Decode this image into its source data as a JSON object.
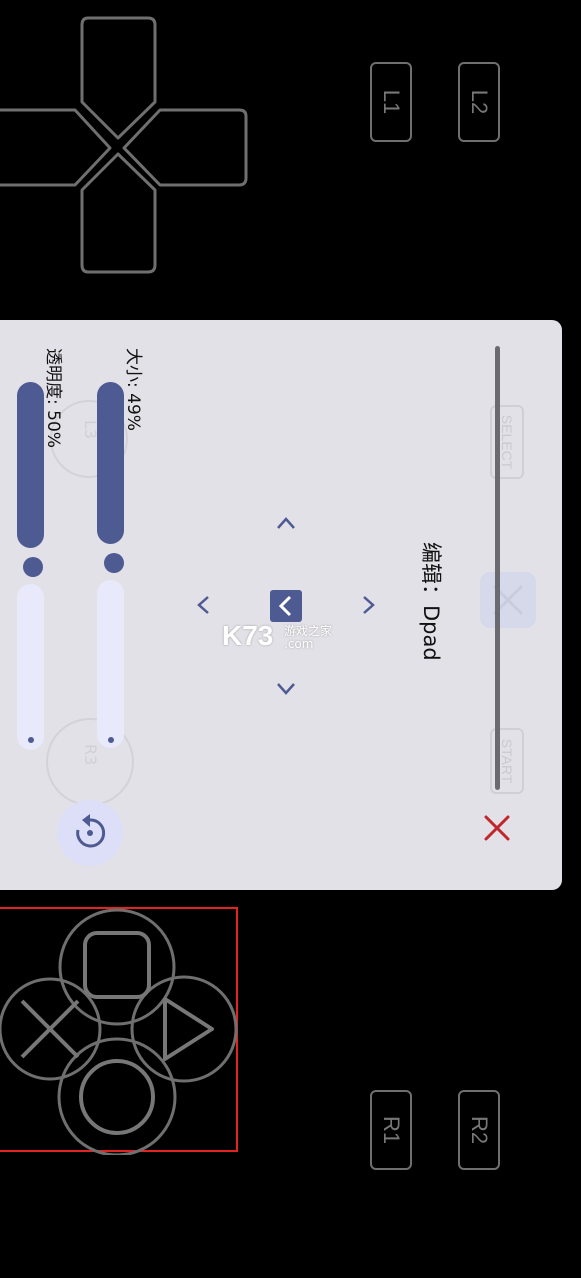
{
  "buttons": {
    "l1": "L1",
    "l2": "L2",
    "r1": "R1",
    "r2": "R2",
    "select": "SELECT",
    "start": "START",
    "l3": "L3",
    "r3": "R3"
  },
  "panel": {
    "title": "编辑：Dpad",
    "size_label": "大小: 49%",
    "opacity_label": "透明度: 50%",
    "size_value": 0.49,
    "opacity_value": 0.5
  },
  "watermark": {
    "brand": "K73",
    "line1": "游戏之家",
    "line2": ".com"
  },
  "icons": {
    "close": "close-icon",
    "reset": "reset-icon"
  },
  "colors": {
    "accent": "#4d5b92",
    "close": "#c0272d",
    "panel": "#e3e1e8",
    "outline": "#707070",
    "selection": "#e32222"
  }
}
